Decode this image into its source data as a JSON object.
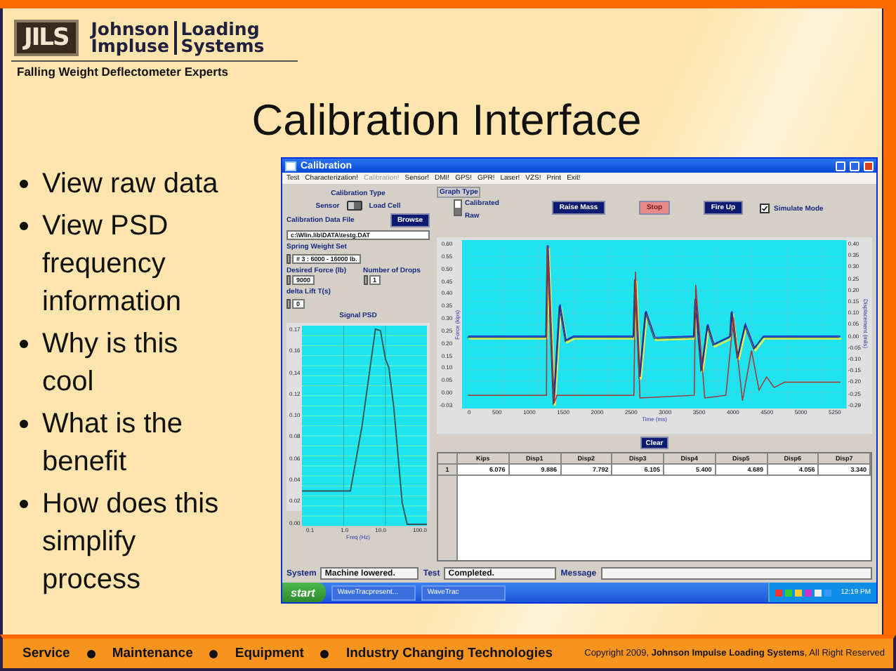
{
  "logo": {
    "mark": "JILS",
    "line1_left": "Johnson",
    "line1_right": "Loading",
    "line2_left": "Impluse",
    "line2_right": "Systems",
    "tagline": "Falling Weight Deflectometer Experts"
  },
  "title": "Calibration Interface",
  "bullets": [
    "View raw data",
    "View PSD frequency information",
    "Why is this cool",
    "What is the benefit",
    "How does this simplify process"
  ],
  "app": {
    "title": "Calibration",
    "menu": [
      {
        "label": "Test",
        "disabled": false
      },
      {
        "label": "Characterization!",
        "disabled": false
      },
      {
        "label": "Calibration!",
        "disabled": true
      },
      {
        "label": "Sensor!",
        "disabled": false
      },
      {
        "label": "DMI!",
        "disabled": false
      },
      {
        "label": "GPS!",
        "disabled": false
      },
      {
        "label": "GPR!",
        "disabled": false
      },
      {
        "label": "Laser!",
        "disabled": false
      },
      {
        "label": "VZS!",
        "disabled": false
      },
      {
        "label": "Print",
        "disabled": false
      },
      {
        "label": "Exit!",
        "disabled": false
      }
    ],
    "calibration_type": {
      "label": "Calibration Type",
      "left": "Sensor",
      "right": "Load Cell",
      "on": false
    },
    "data_file": {
      "label": "Calibration Data File",
      "button": "Browse",
      "value": "c:\\Wlin.lib\\DATA\\testg.DAT"
    },
    "spring_weight": {
      "label": "Spring Weight Set",
      "value": "# 3 : 6000 - 16000 lb."
    },
    "desired_force": {
      "label": "Desired Force (lb)",
      "value": "9000"
    },
    "drops": {
      "label": "Number of Drops",
      "value": "1"
    },
    "delta_lift": {
      "label": "delta Lift T(s)",
      "value": "0"
    },
    "psd": {
      "title": "Signal PSD",
      "yticks": [
        "0.17",
        "0.16",
        "0.14",
        "0.12",
        "0.10",
        "0.08",
        "0.06",
        "0.04",
        "0.02",
        "0.00"
      ],
      "xticks": [
        "0.1",
        "1.0",
        "10.0",
        "100.0"
      ],
      "xlabel": "Freq (Hz)"
    },
    "graph_type": {
      "label": "Graph Type",
      "options": [
        {
          "label": "Calibrated",
          "selected": false
        },
        {
          "label": "Raw",
          "selected": true
        }
      ]
    },
    "buttons": [
      {
        "label": "Raise Mass",
        "kind": "primary"
      },
      {
        "label": "Stop",
        "kind": "stop"
      },
      {
        "label": "Fire Up",
        "kind": "primary"
      }
    ],
    "simulate": {
      "label": "Simulate Mode",
      "checked": true
    },
    "waveform": {
      "left_ticks": [
        "0.60",
        "0.55",
        "0.50",
        "0.45",
        "0.40",
        "0.35",
        "0.30",
        "0.25",
        "0.20",
        "0.15",
        "0.10",
        "0.05",
        "0.00",
        "-0.03"
      ],
      "right_ticks": [
        "0.40",
        "0.35",
        "0.30",
        "0.25",
        "0.20",
        "0.15",
        "0.10",
        "0.05",
        "0.00",
        "-0.05",
        "-0.10",
        "-0.15",
        "-0.20",
        "-0.25",
        "-0.29"
      ],
      "x_ticks": [
        "0",
        "500",
        "1000",
        "1500",
        "2000",
        "2500",
        "3000",
        "3500",
        "4000",
        "4500",
        "5000",
        "5250"
      ],
      "ylabel": "Force (kips)",
      "y2label": "Displacement (mils)",
      "xlabel": "Time (ms)"
    },
    "clear_button": "Clear",
    "table": {
      "columns": [
        "Kips",
        "Disp1",
        "Disp2",
        "Disp3",
        "Disp4",
        "Disp5",
        "Disp6",
        "Disp7"
      ],
      "rows": [
        {
          "index": "1",
          "cells": [
            "6.076",
            "9.886",
            "7.792",
            "6.105",
            "5.400",
            "4.689",
            "4.056",
            "3.340"
          ]
        }
      ]
    },
    "status": [
      {
        "label": "System",
        "value": "Machine lowered."
      },
      {
        "label": "Test",
        "value": "Completed."
      },
      {
        "label": "Message"
      }
    ],
    "taskbar": {
      "start": "start",
      "tasks": [
        "WaveTracpresent...",
        "WaveTrac"
      ],
      "clock": "12:19 PM"
    }
  },
  "footer": {
    "items": [
      "Service",
      "Maintenance",
      "Equipment",
      "Industry Changing Technologies"
    ],
    "copyright": "Copyright 2009, **Johnson Impulse Loading Systems**, All Right Reserved"
  }
}
